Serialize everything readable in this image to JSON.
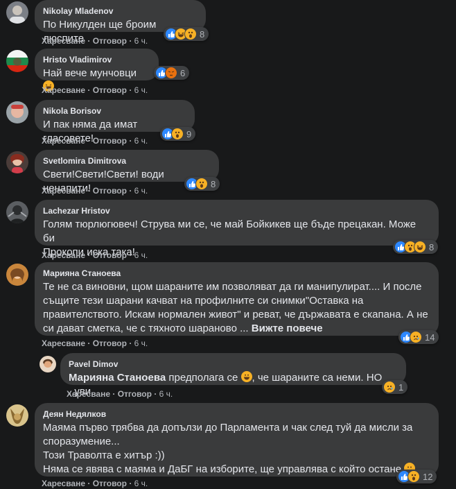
{
  "actions": {
    "like": "Харесване",
    "reply": "Отговор",
    "sep": "·"
  },
  "comments": [
    {
      "author": "Nikolay Mladenov",
      "text": "По Никулден ще броим люспите",
      "time": "6 ч.",
      "reactions": [
        "like-icon",
        "haha-icon",
        "wow-icon"
      ],
      "count": "8"
    },
    {
      "author": "Hristo Vladimirov",
      "text": "Най вече мунчовци",
      "emoji": "laughing-emoji",
      "time": "6 ч.",
      "reactions": [
        "like-icon",
        "angry-icon"
      ],
      "count": "6"
    },
    {
      "author": "Nikola Borisov",
      "text": "И пак няма да имат гласовете!",
      "time": "6 ч.",
      "reactions": [
        "like-icon",
        "wow-icon"
      ],
      "count": "9"
    },
    {
      "author": "Svetlomira Dimitrova",
      "text": "Свети!Свети!Свети! води ненапити!",
      "time": "6 ч.",
      "reactions": [
        "like-icon",
        "wow-icon"
      ],
      "count": "8"
    },
    {
      "author": "Lachezar Hristov",
      "text_line1": "Голям тюрлюгювеч! Струва ми се, че май Бойкикев ще бъде прецакан. Може би",
      "text_line2": "Прокопи иска така!",
      "time": "6 ч.",
      "reactions": [
        "like-icon",
        "wow-icon",
        "haha-icon"
      ],
      "count": "8"
    },
    {
      "author": "Марияна Станоева",
      "text_line1": "Те не са виновни, щом шараните им позволяват да ги манипулират.... И после",
      "text_line2": "същите тези шарани качват на профилните си снимки\"Оставка на",
      "text_line3": "правителството. Искам нормален живот\" и реват, че държавата е скапана. А не",
      "text_line4": "си дават сметка, че с тяхното шараново ...",
      "see_more": "Вижте повече",
      "time": "6 ч.",
      "reactions": [
        "like-icon",
        "sad-icon"
      ],
      "count": "14"
    },
    {
      "author": "Pavel Dimov",
      "mention": "Марияна Станоева",
      "text_a": "предполага се",
      "text_b": ", че шараните са неми. НО ..уви",
      "emoji": "grinning-emoji",
      "time": "6 ч.",
      "reactions": [
        "sad-icon"
      ],
      "count": "1"
    },
    {
      "author": "Деян Недялков",
      "text_line1": "Маяма първо трябва да допълзи до Парламента и чак след туй да мисли за",
      "text_line2": "споразумение...",
      "text_line3": "Този Траволта е хитър :))",
      "text_line4": "Няма се явява с маяма и ДаБГ на изборите, ще управлява с който остане",
      "emoji": "smiling-emoji",
      "time": "6 ч.",
      "reactions": [
        "like-icon",
        "wow-icon"
      ],
      "count": "12"
    }
  ]
}
